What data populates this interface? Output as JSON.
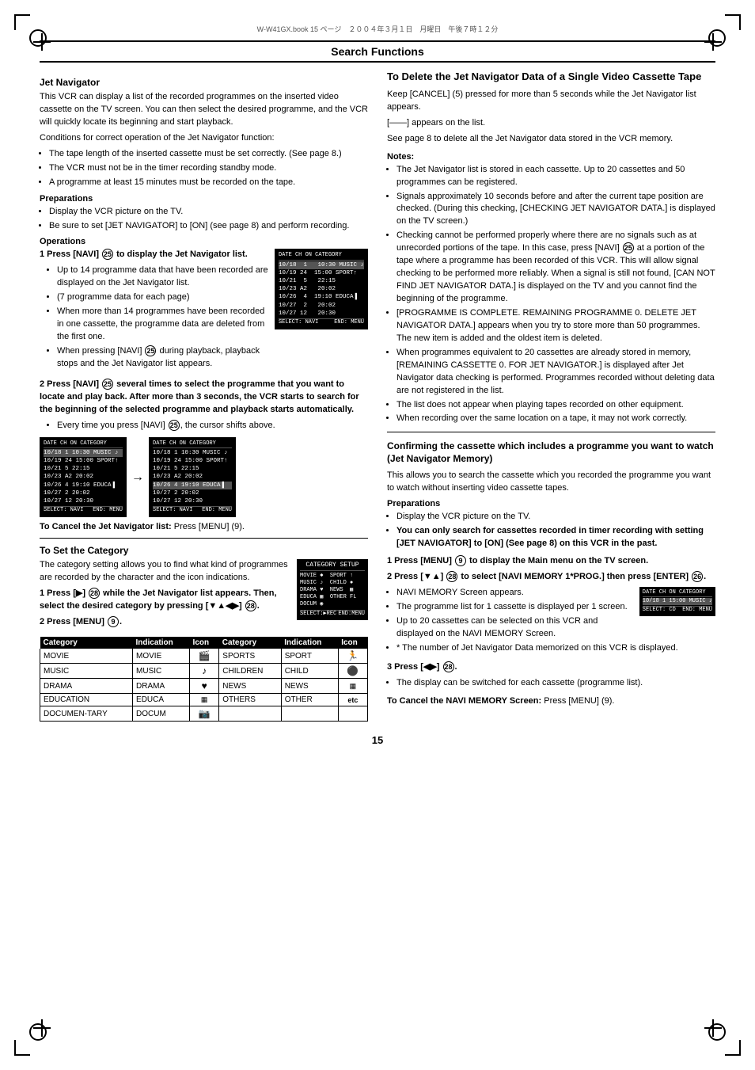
{
  "page": {
    "header_meta": "W-W41GX.book  15 ページ　２００４年３月１日　月曜日　午後７時１２分",
    "page_number": "15",
    "section_title": "Search Functions"
  },
  "left_col": {
    "jet_nav_heading": "Jet Navigator",
    "jet_nav_intro": "This VCR can display a list of the recorded programmes on the inserted video cassette on the TV screen. You can then select the desired programme, and the VCR will quickly locate its beginning and start playback.",
    "jet_nav_conditions": "Conditions for correct operation of the Jet Navigator function:",
    "conditions_list": [
      "The tape length of the inserted cassette must be set correctly. (See page 8.)",
      "The VCR must not be in the timer recording standby mode.",
      "A programme at least 15 minutes must be recorded on the tape."
    ],
    "preparations_heading": "Preparations",
    "preparations_list": [
      "Display the VCR picture on the TV.",
      "Be sure to set [JET NAVIGATOR] to [ON] (see page 8) and perform recording."
    ],
    "operations_heading": "Operations",
    "ops": [
      {
        "num": "1",
        "title": "Press [NAVI] (25) to display the Jet Navigator list.",
        "body_items": [
          "Up to 14 programme data that have been recorded are displayed on the Jet Navigator list.",
          "(7 programme data for each page)",
          "When more than 14 programmes have been recorded in one cassette, the programme data are deleted from the first one.",
          "When pressing [NAVI] (25) during playback, playback stops and the Jet Navigator list appears."
        ]
      },
      {
        "num": "2",
        "title": "Press [NAVI] (25) several times to select the programme that you want to locate and play back. After more than 3 seconds, the VCR starts to search for the beginning of the selected programme and playback starts automatically.",
        "body_items": [
          "Every time you press [NAVI] (25), the cursor shifts above."
        ]
      }
    ],
    "cancel_nav_title": "To Cancel the Jet Navigator list:",
    "cancel_nav_text": "Press [MENU] (9).",
    "set_category_heading": "To Set the Category",
    "set_category_intro": "The category setting allows you to find what kind of programmes are recorded by the character and the icon indications.",
    "set_category_ops": [
      {
        "num": "1",
        "title": "Press [▶] (28) while the Jet Navigator list appears. Then, select the desired category by pressing [▼▲◀▶] (28)."
      },
      {
        "num": "2",
        "title": "Press [MENU] (9)."
      }
    ],
    "category_table": {
      "headers": [
        "Category",
        "Indication",
        "Icon",
        "Category",
        "Indication",
        "Icon"
      ],
      "rows": [
        [
          "MOVIE",
          "MOVIE",
          "🎬",
          "SPORTS",
          "SPORT",
          "🏃"
        ],
        [
          "MUSIC",
          "MUSIC",
          "🎵",
          "CHILDREN",
          "CHILD",
          "⚫"
        ],
        [
          "DRAMA",
          "DRAMA",
          "❤",
          "NEWS",
          "NEWS",
          "📰"
        ],
        [
          "EDUCATION",
          "EDUCA",
          "📺",
          "OTHERS",
          "OTHER",
          "etc"
        ],
        [
          "DOCUMEN-TARY",
          "DOCUM",
          "📷",
          "",
          "",
          ""
        ]
      ]
    }
  },
  "right_col": {
    "delete_heading": "To Delete the Jet Navigator Data of a Single Video Cassette Tape",
    "delete_intro": "Keep [CANCEL] (5) pressed for more than 5 seconds while the Jet Navigator list appears.",
    "delete_note1": "[——] appears on the list.",
    "delete_note2": "See page 8 to delete all the Jet Navigator data stored in the VCR memory.",
    "notes_label": "Notes:",
    "notes": [
      "The Jet Navigator list is stored in each cassette. Up to 20 cassettes and 50 programmes can be registered.",
      "Signals approximately 10 seconds before and after the current tape position are checked. (During this checking, [CHECKING JET NAVIGATOR DATA.] is displayed on the TV screen.)",
      "Checking cannot be performed properly where there are no signals such as at unrecorded portions of the tape. In this case, press [NAVI] (25) at a portion of the tape where a programme has been recorded of this VCR. This will allow signal checking to be performed more reliably. When a signal is still not found, [CAN NOT FIND JET NAVIGATOR DATA.] is displayed on the TV and you cannot find the beginning of the programme.",
      "[PROGRAMME IS COMPLETE. REMAINING PROGRAMME 0. DELETE JET NAVIGATOR DATA.] appears when you try to store more than 50 programmes. The new item is added and the oldest item is deleted.",
      "When programmes equivalent to 20 cassettes are already stored in memory, [REMAINING CASSETTE 0. FOR JET NAVIGATOR.] is displayed after Jet Navigator data checking is performed. Programmes recorded without deleting data are not registered in the list.",
      "The list does not appear when playing tapes recorded on other equipment.",
      "When recording over the same location on a tape, it may not work correctly."
    ],
    "confirm_heading": "Confirming the cassette which includes a programme you want to watch (Jet Navigator Memory)",
    "confirm_intro": "This allows you to search the cassette which you recorded the programme you want to watch without inserting video cassette tapes.",
    "confirm_preparations_heading": "Preparations",
    "confirm_preparations_list": [
      "Display the VCR picture on the TV.",
      "You can only search for cassettes recorded in timer recording with setting [JET NAVIGATOR] to [ON] (See page 8) on this VCR in the past."
    ],
    "confirm_ops": [
      {
        "num": "1",
        "title": "Press [MENU] (9) to display the Main menu on the TV screen."
      },
      {
        "num": "2",
        "title": "Press [▼▲] (28) to select [NAVI MEMORY 1*PROG.] then press [ENTER] (26).",
        "body_items": [
          "NAVI MEMORY Screen appears.",
          "The programme list for 1 cassette is displayed per 1 screen.",
          "Up to 20 cassettes can be selected on this VCR and displayed on the NAVI MEMORY Screen.",
          "* The number of Jet Navigator Data memorized on this VCR is displayed."
        ]
      },
      {
        "num": "3",
        "title": "Press [◀▶] (28).",
        "body_items": [
          "The display can be switched for each cassette (programme list)."
        ]
      }
    ],
    "cancel_navi_title": "To Cancel the NAVI MEMORY Screen:",
    "cancel_navi_text": "Press [MENU] (9)."
  },
  "screens": {
    "nav_list_1": {
      "header": "DATE  CH   ON   CATEGORY",
      "rows": [
        "10/18  1   10:30  MUSIC  ♪",
        "10/19  24  15:00  SPORT ↑",
        "10/21  5   22:15",
        "10/23  A2  20:02",
        "10/26  4   19:10  EDUCA▐",
        "10/27  2   20:02",
        "10/27  12  20:30"
      ],
      "footer": "SELECT: NAVI  END: MENU"
    },
    "nav_list_2": {
      "header": "DATE  CH   ON   CATEGORY",
      "rows": [
        "10/18  1   10:30  MUSIC  ♪",
        "10/19  24  15:00  SPORT ↑",
        "10/21  5   22:15",
        "10/23  A2  20:02",
        "10/26  4   19:10  EDUCA▐",
        "10/27  2   20:02",
        "10/27  12  20:30"
      ],
      "highlight_row": 0,
      "footer": "SELECT: NAVI  END: MENU"
    },
    "category_screen": {
      "title": "CATEGORY SETUP",
      "rows": [
        "MOVIE  ✱   SPORT  ↑",
        "MUSIC  ♪   CHILD  ●",
        "DRAMA  ♥   NEWS   ▦",
        "EDUCA  ▦   OTHER  FL",
        "DOCUM  ◉"
      ],
      "footer": "SELECT: ▶REC  END: MENU"
    },
    "navi_memory_screen": {
      "header": "DATE  CH   ON   CATEGORY",
      "rows": [
        "10/18  1   15:00  MUSIC  ♪"
      ],
      "footer": "SELECT: CD  END: MENU"
    }
  }
}
